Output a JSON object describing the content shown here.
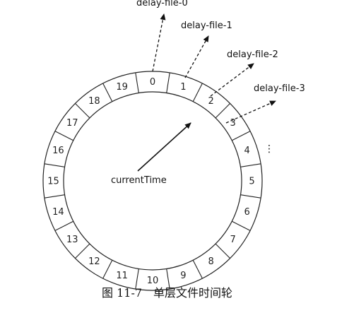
{
  "slots": [
    "0",
    "1",
    "2",
    "3",
    "4",
    "5",
    "6",
    "7",
    "8",
    "9",
    "10",
    "11",
    "12",
    "13",
    "14",
    "15",
    "16",
    "17",
    "18",
    "19"
  ],
  "current_time_label": "currentTime",
  "delay_files": [
    {
      "label": "delay-file-0"
    },
    {
      "label": "delay-file-1"
    },
    {
      "label": "delay-file-2"
    },
    {
      "label": "delay-file-3"
    }
  ],
  "ellipsis": "⋮",
  "caption": "图 11-7　单层文件时间轮"
}
